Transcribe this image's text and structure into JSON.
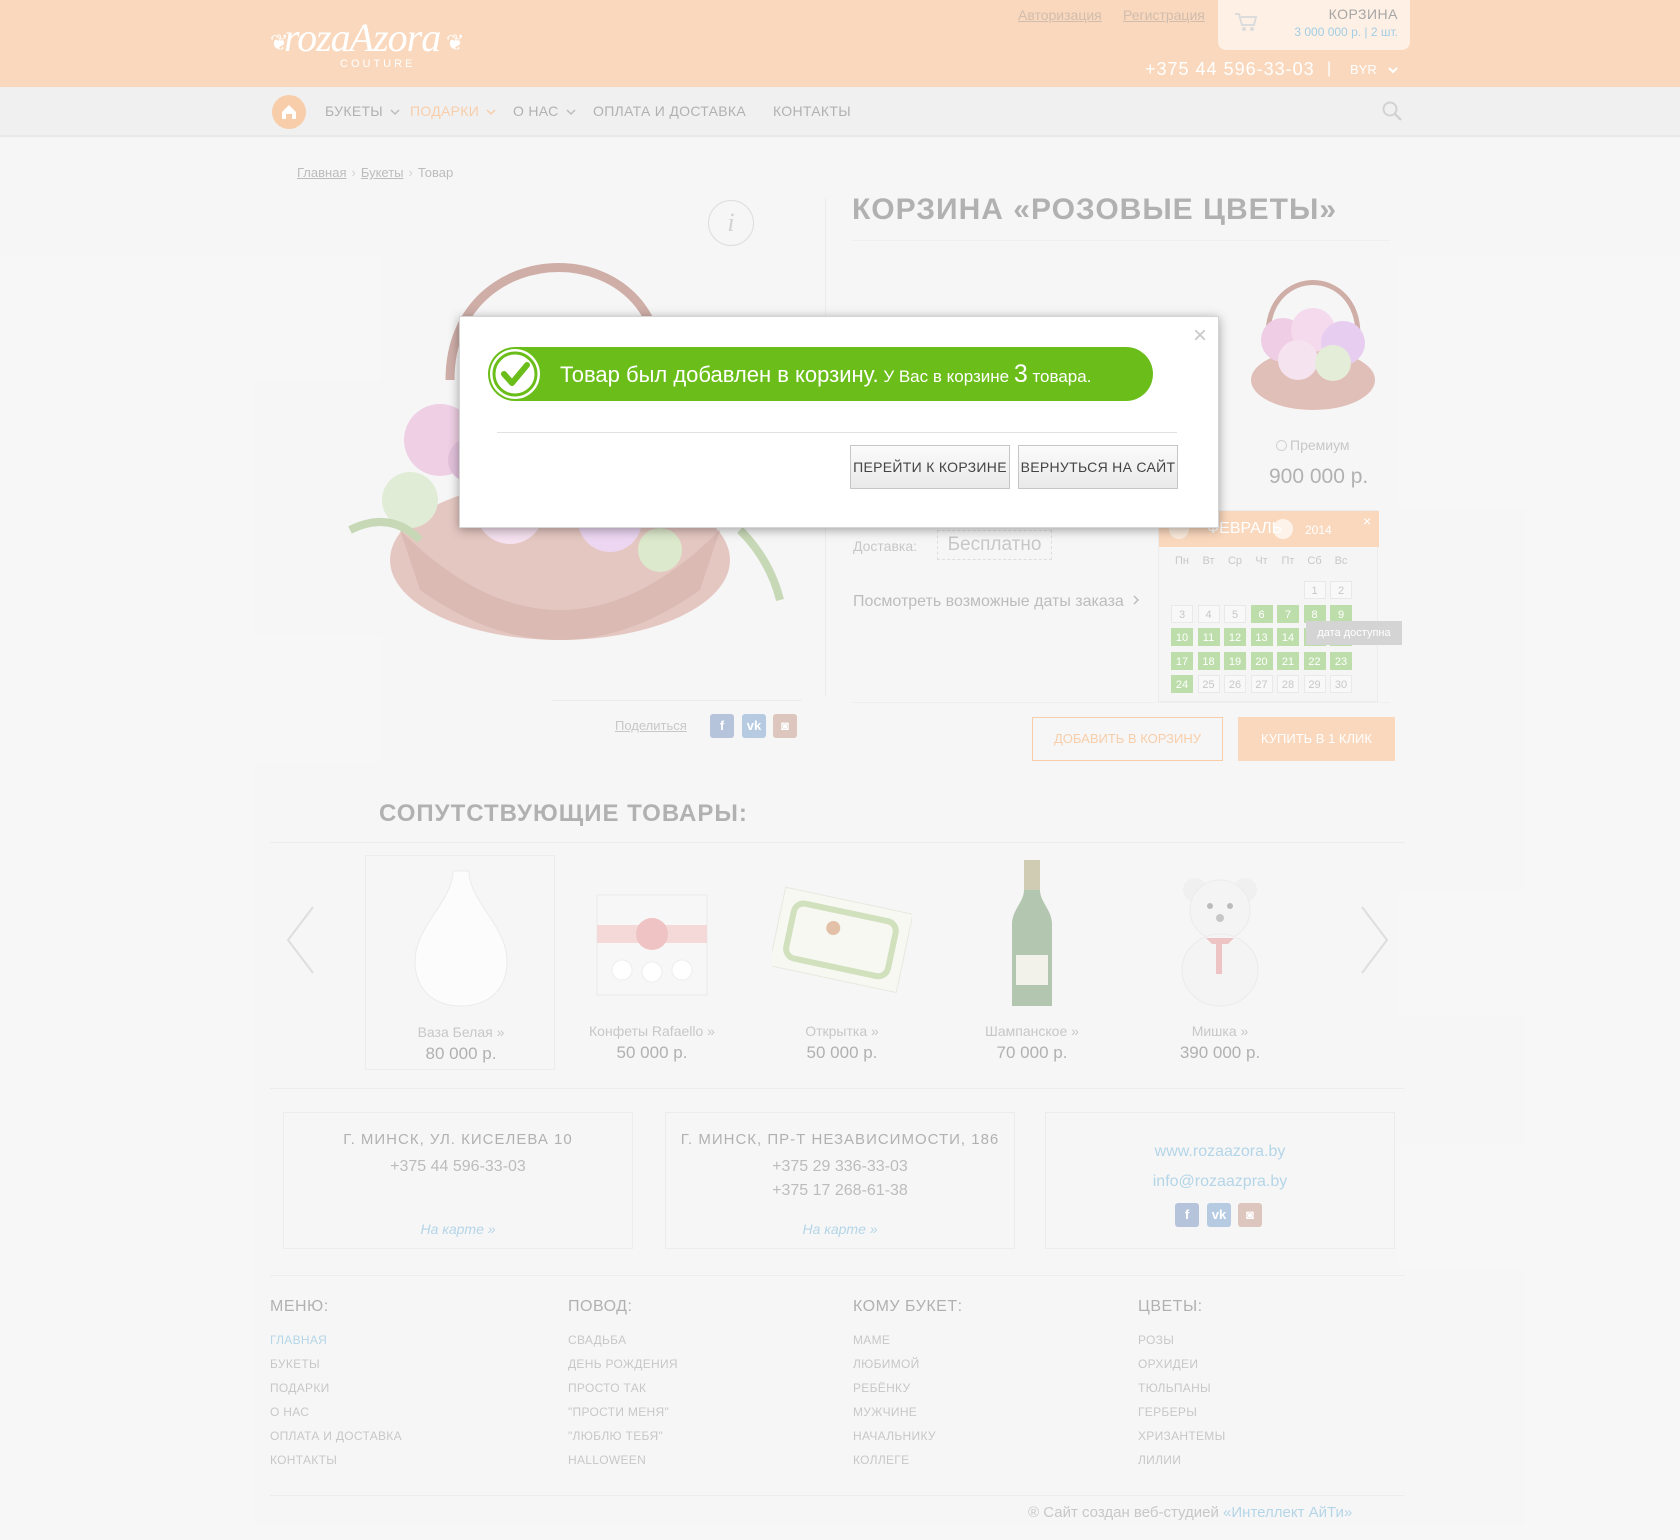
{
  "header": {
    "logo_text": "rozaAzora",
    "logo_sub": "COUTURE",
    "login": "Авторизация",
    "register": "Регистрация",
    "cart": {
      "title": "КОРЗИНА",
      "summary": "3 000 000 р. | 2 шт."
    },
    "phone": "+375 44 596-33-03",
    "separator": "|",
    "currency": "BYR"
  },
  "nav": {
    "items": [
      {
        "label": "БУКЕТЫ",
        "has_dropdown": true,
        "active": false
      },
      {
        "label": "ПОДАРКИ",
        "has_dropdown": true,
        "active": true
      },
      {
        "label": "О НАС",
        "has_dropdown": true,
        "active": false
      },
      {
        "label": "ОПЛАТА И ДОСТАВКА",
        "has_dropdown": false,
        "active": false
      },
      {
        "label": "КОНТАКТЫ",
        "has_dropdown": false,
        "active": false
      }
    ]
  },
  "breadcrumb": {
    "items": [
      "Главная",
      "Букеты"
    ],
    "current": "Товар",
    "separator": "›"
  },
  "product": {
    "info_label": "i",
    "title": "КОРЗИНА «РОЗОВЫЕ ЦВЕТЫ»",
    "variant_name": "Премиум",
    "variant_price": "900 000 р.",
    "delivery_label": "Доставка:",
    "delivery_value": "Бесплатно",
    "dates_link": "Посмотреть возможные даты заказа",
    "add_to_cart": "ДОБАВИТЬ В КОРЗИНУ",
    "buy_one_click": "КУПИТЬ В 1 КЛИК",
    "share_label": "Поделиться"
  },
  "calendar": {
    "month": "ФЕВРАЛЬ",
    "year": "2014",
    "close": "×",
    "weekdays": [
      "Пн",
      "Вт",
      "Ср",
      "Чт",
      "Пт",
      "Сб",
      "Вс"
    ],
    "first_weekday": 5,
    "days_in_month": 30,
    "available_days": [
      6,
      7,
      8,
      9,
      10,
      11,
      12,
      13,
      14,
      15,
      16,
      17,
      18,
      19,
      20,
      21,
      22,
      23,
      24
    ],
    "tooltip": "дата доступна"
  },
  "related": {
    "title": "СОПУТСТВУЮЩИЕ ТОВАРЫ:",
    "items": [
      {
        "name": "Ваза Белая",
        "price": "80 000 р."
      },
      {
        "name": "Конфеты Rafaello",
        "price": "50 000 р."
      },
      {
        "name": "Открытка",
        "price": "50 000 р."
      },
      {
        "name": "Шампанское",
        "price": "70 000 р."
      },
      {
        "name": "Мишка",
        "price": "390 000 р."
      }
    ],
    "more": "»"
  },
  "contacts": {
    "addr1": {
      "title": "Г. МИНСК, УЛ. КИСЕЛЕВА 10",
      "phone1": "+375 44 596-33-03",
      "map": "На карте »"
    },
    "addr2": {
      "title": "Г. МИНСК, ПР-Т НЕЗАВИСИМОСТИ, 186",
      "phone1": "+375 29 336-33-03",
      "phone2": "+375 17 268-61-38",
      "map": "На карте »"
    },
    "site": "www.rozaazora.by",
    "email": "info@rozaazpra.by"
  },
  "footer": {
    "columns": [
      {
        "title": "МЕНЮ:",
        "items": [
          "ГЛАВНАЯ",
          "БУКЕТЫ",
          "ПОДАРКИ",
          "О НАС",
          "ОПЛАТА И ДОСТАВКА",
          "КОНТАКТЫ"
        ]
      },
      {
        "title": "ПОВОД:",
        "items": [
          "СВАДЬБА",
          "ДЕНЬ РОЖДЕНИЯ",
          "ПРОСТО ТАК",
          "\"ПРОСТИ МЕНЯ\"",
          "\"ЛЮБЛЮ ТЕБЯ\"",
          "HALLOWEEN"
        ]
      },
      {
        "title": "КОМУ БУКЕТ:",
        "items": [
          "МАМЕ",
          "ЛЮБИМОЙ",
          "РЕБЁНКУ",
          "МУЖЧИНЕ",
          "НАЧАЛЬНИКУ",
          "КОЛЛЕГЕ"
        ]
      },
      {
        "title": "ЦВЕТЫ:",
        "items": [
          "РОЗЫ",
          "ОРХИДЕИ",
          "ТЮЛЬПАНЫ",
          "ГЕРБЕРЫ",
          "ХРИЗАНТЕМЫ",
          "ЛИЛИИ"
        ]
      }
    ],
    "credits": "® Сайт создан веб-студией ",
    "studio": "«Интеллект АйТи»"
  },
  "modal": {
    "close": "×",
    "message_main": "Товар был добавлен в корзину.",
    "message_pre": " У Вас в корзине ",
    "count": "3",
    "message_post": " товара.",
    "go_to_cart": "ПЕРЕЙТИ К КОРЗИНЕ",
    "back_to_site": "ВЕРНУТЬСЯ НА САЙТ"
  },
  "colors": {
    "header_bg": "#f7c49a",
    "accent": "#f4b37c",
    "success": "#6bbe1a",
    "calendar_available": "#9acc7e",
    "link_blue": "#8dbfdc"
  },
  "icons": {
    "home": "home-icon",
    "search": "search-icon",
    "cart": "cart-icon",
    "check": "check-icon",
    "close": "close-icon",
    "facebook": "facebook-icon",
    "vk": "vk-icon",
    "instagram": "instagram-icon"
  }
}
